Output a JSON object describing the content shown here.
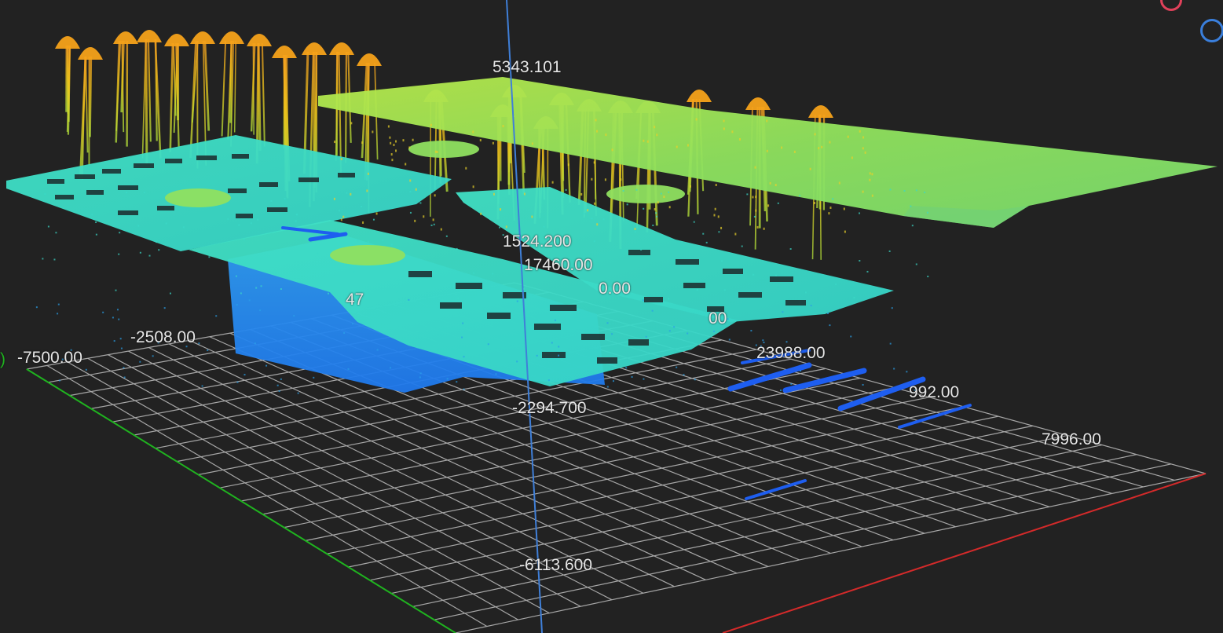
{
  "viewer": {
    "colors": {
      "background": "#222222",
      "grid": "#bfbfbf",
      "x_axis": "#d42a2a",
      "y_axis": "#1fb31f",
      "z_axis": "#3f7fd8",
      "label": "#e6e6e6",
      "gizmo_red": "#e0415a",
      "gizmo_blue": "#3a7fdc"
    },
    "gizmo": {
      "icons": [
        "x-axis-gizmo-icon",
        "z-axis-gizmo-icon"
      ]
    },
    "axis_labels": {
      "z_top": "5343.101",
      "z_mid": "1524.200",
      "depth_1": "17460.00",
      "depth_2": "0.00",
      "depth_3": "00",
      "depth_4": "47",
      "y_start": "-7500.00",
      "y_tick": "-2508.00",
      "x_tick_1": "23988.00",
      "x_tick_2": "992.00",
      "x_end": "7996.00",
      "z_low": "-2294.700",
      "z_bottom": "-6113.600",
      "left_edge": ")"
    }
  }
}
